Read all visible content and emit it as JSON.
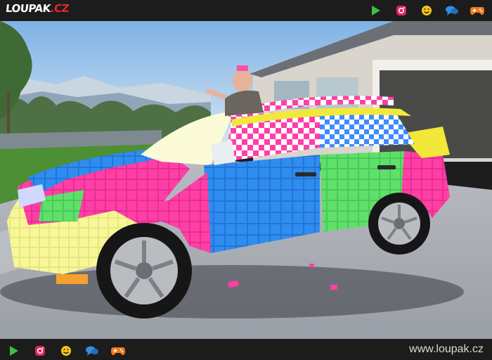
{
  "header": {
    "logo_main": "LOUPAK",
    "logo_domain": ".CZ",
    "icons": [
      "play-icon",
      "instagram-icon",
      "smiley-icon",
      "chat-icon",
      "gamepad-icon"
    ]
  },
  "footer": {
    "url": "www.loupak.cz",
    "icons": [
      "play-icon",
      "instagram-icon",
      "smiley-icon",
      "chat-icon",
      "gamepad-icon"
    ]
  },
  "colors": {
    "bar_bg": "#1c1c1c",
    "play": "#3fbf3f",
    "instagram": "#e0245e",
    "smiley": "#f5c518",
    "chat": "#2f8fe0",
    "gamepad": "#f07a1a",
    "logo_accent": "#e32a2a"
  },
  "photo": {
    "subject": "car-covered-in-sticky-notes"
  }
}
